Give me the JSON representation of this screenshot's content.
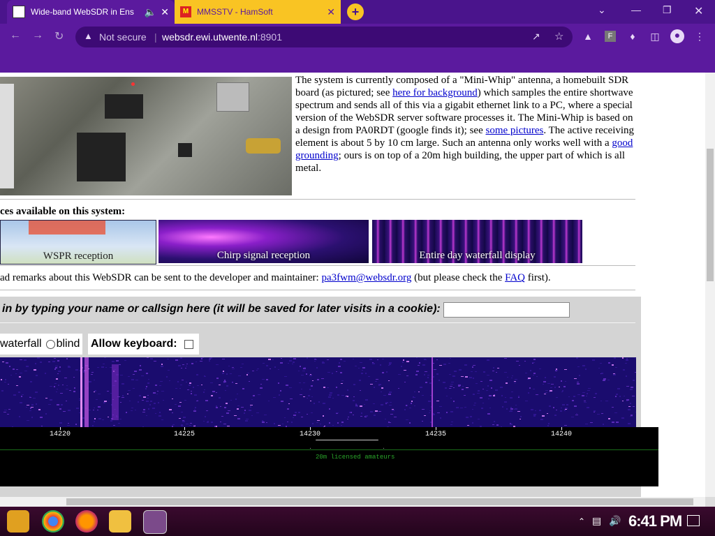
{
  "browser": {
    "tabs": [
      {
        "title": "Wide-band WebSDR in Ens",
        "active": true,
        "audio_icon": "speaker-icon"
      },
      {
        "title": "MMSSTV - HamSoft",
        "active": false
      }
    ],
    "new_tab_label": "+",
    "address": {
      "security_label": "Not secure",
      "host": "websdr.ewi.utwente.nl",
      "port": ":8901"
    }
  },
  "page": {
    "description_parts": {
      "p1": "The system is currently composed of a \"Mini-Whip\" antenna, a homebuilt SDR board (as pictured; see ",
      "link1": "here for background",
      "p2": ") which samples the entire shortwave spectrum and sends all of this via a gigabit ethernet link to a PC, where a special version of the WebSDR server software processes it. The Mini-Whip is based on a design from PA0RDT (google finds it); see ",
      "link2": "some pictures",
      "p3": ". The active receiving element is about 5 by 10 cm large. Such an antenna only works well with a ",
      "link3": "good grounding",
      "p4": "; ours is on top of a 20m high building, the upper part of which is all metal."
    },
    "services_heading": "ces available on this system:",
    "services": [
      {
        "label": "WSPR reception"
      },
      {
        "label": "Chirp signal reception"
      },
      {
        "label": "Entire day waterfall display"
      }
    ],
    "remarks": {
      "p1": "ad remarks about this WebSDR can be sent to the developer and maintainer: ",
      "email": "pa3fwm@websdr.org",
      "p2": " (but please check the ",
      "faq": "FAQ",
      "p3": " first)."
    },
    "login_prompt": "in by typing your name or callsign here (it will be saved for later visits in a cookie):",
    "callsign_value": "",
    "view_options": {
      "waterfall_label": "waterfall",
      "blind_label": "blind"
    },
    "keyboard_label": "Allow keyboard:",
    "frequency_ticks": [
      "14220",
      "14225",
      "14230",
      "14235",
      "14240"
    ],
    "band_label": "20m licensed amateurs"
  },
  "taskbar": {
    "clock": "6:41 PM"
  },
  "colors": {
    "chrome_purple": "#5b1a9e",
    "tab_yellow": "#f9c423",
    "link_blue": "#0000cc"
  }
}
